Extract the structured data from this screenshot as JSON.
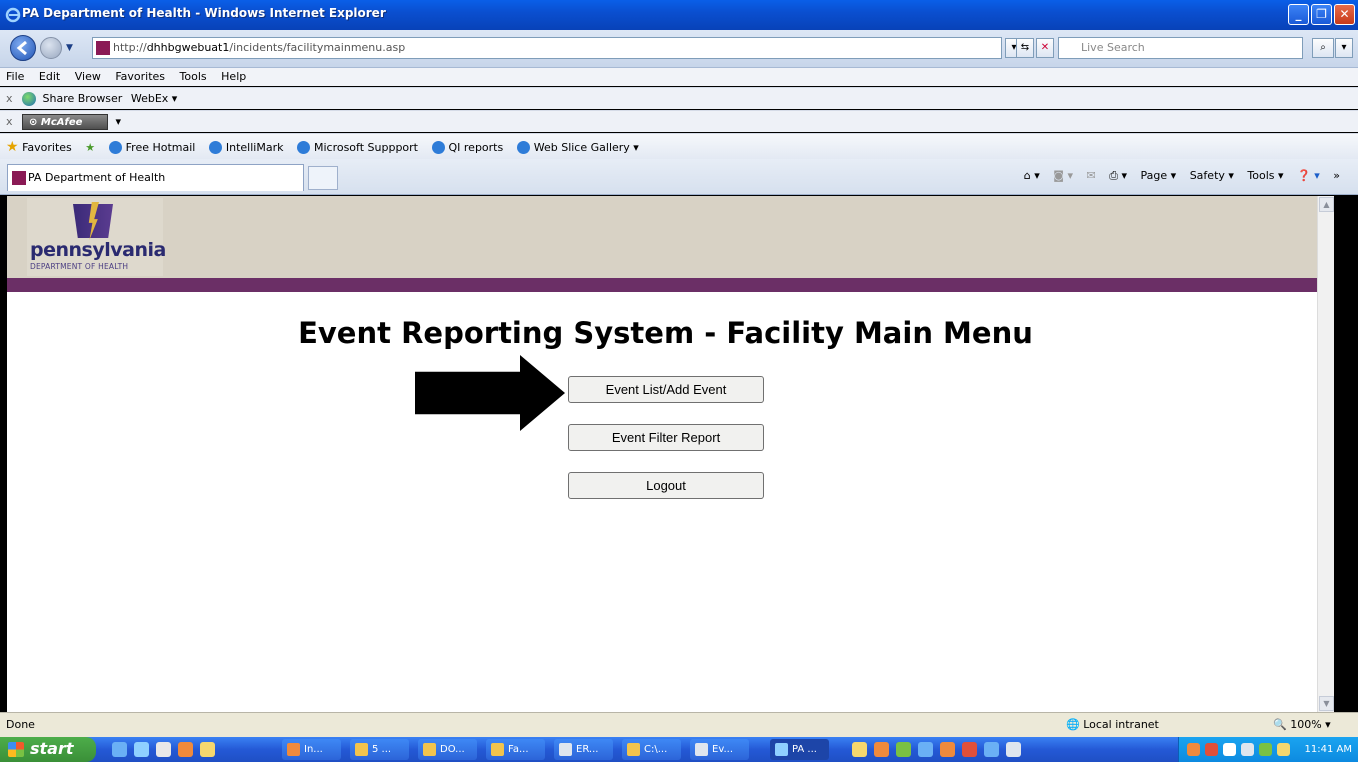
{
  "window": {
    "title": "PA Department of Health - Windows Internet Explorer"
  },
  "address": {
    "prefix": "http://",
    "host": "dhhbgwebuat1",
    "path": "/incidents/facilitymainmenu.asp",
    "search_placeholder": "Live Search"
  },
  "menubar": {
    "items": [
      "File",
      "Edit",
      "View",
      "Favorites",
      "Tools",
      "Help"
    ]
  },
  "toolbar1": {
    "share": "Share Browser",
    "webex": "WebEx ▾"
  },
  "toolbar2": {
    "mcafee": "McAfee"
  },
  "favorites": {
    "label": "Favorites",
    "links": [
      "Free Hotmail",
      "IntelliMark",
      "Microsoft Suppport",
      "QI reports",
      "Web Slice Gallery ▾"
    ]
  },
  "tabs": {
    "active": "PA Department of Health"
  },
  "commandbar": {
    "page": "Page ▾",
    "safety": "Safety ▾",
    "tools": "Tools ▾"
  },
  "page": {
    "logo_name": "pennsylvania",
    "logo_dept": "DEPARTMENT OF HEALTH",
    "title": "Event Reporting System - Facility Main Menu",
    "buttons": {
      "event_list": "Event List/Add Event",
      "filter_report": "Event Filter Report",
      "logout": "Logout"
    }
  },
  "status": {
    "text": "Done",
    "zone": "Local intranet",
    "zoom": "100%"
  },
  "taskbar": {
    "start": "start",
    "items": [
      "In...",
      "5 ...",
      "DO...",
      "Fa...",
      "ER...",
      "C:\\...",
      "Ev...",
      "PA ..."
    ],
    "clock": "11:41 AM"
  }
}
